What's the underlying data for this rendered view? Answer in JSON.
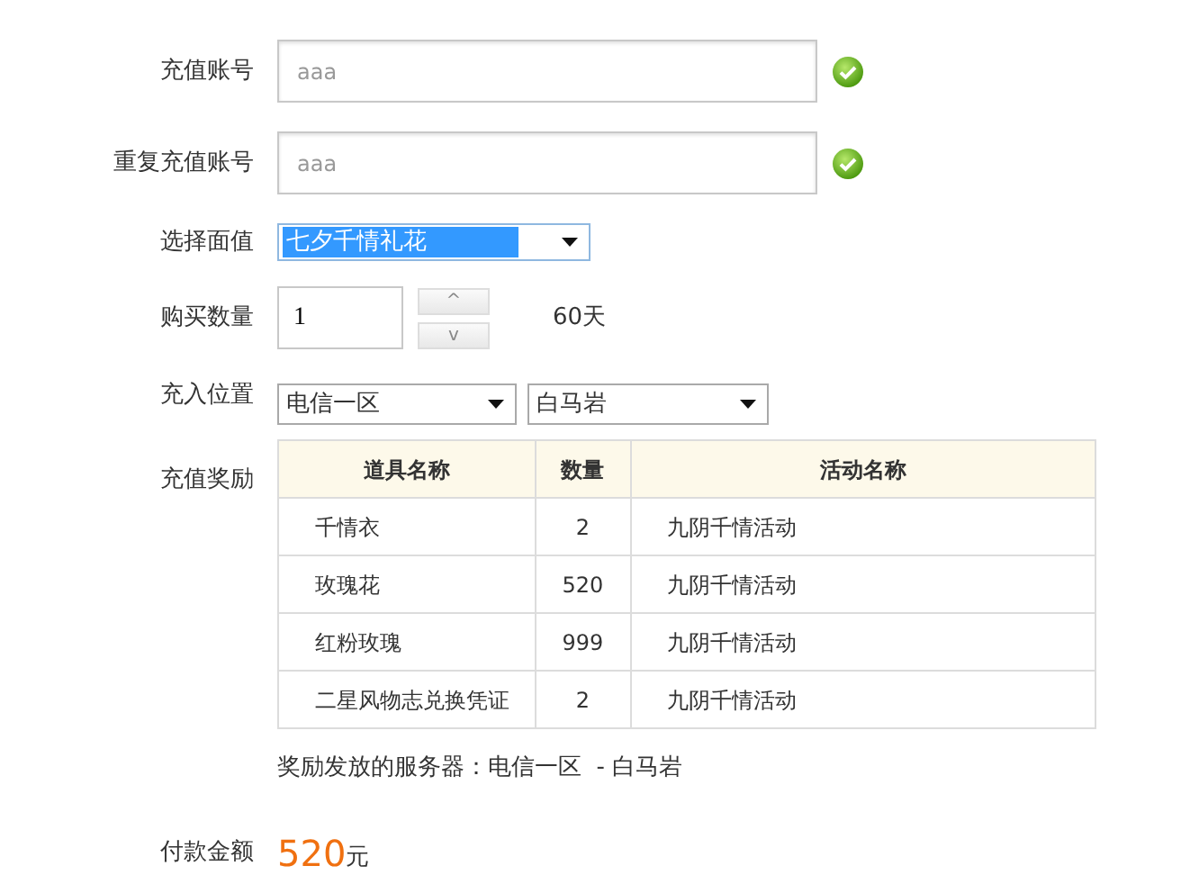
{
  "form": {
    "account": {
      "label": "充值账号",
      "value": "aaa",
      "valid": true
    },
    "account_repeat": {
      "label": "重复充值账号",
      "value": "aaa",
      "valid": true
    },
    "denomination": {
      "label": "选择面值",
      "value": "七夕千情礼花",
      "highlighted": true
    },
    "quantity": {
      "label": "购买数量",
      "value": "1",
      "up": "^",
      "down": "v",
      "duration": "60天"
    },
    "location": {
      "label": "充入位置",
      "zone": "电信一区",
      "server": "白马岩"
    },
    "rewards": {
      "label": "充值奖励",
      "columns": [
        "道具名称",
        "数量",
        "活动名称"
      ],
      "rows": [
        [
          "千情衣",
          "2",
          "九阴千情活动"
        ],
        [
          "玫瑰花",
          "520",
          "九阴千情活动"
        ],
        [
          "红粉玫瑰",
          "999",
          "九阴千情活动"
        ],
        [
          "二星风物志兑换凭证",
          "2",
          "九阴千情活动"
        ]
      ],
      "server_note": "奖励发放的服务器：电信一区  - 白马岩"
    },
    "payment": {
      "label": "付款金额",
      "amount": "520",
      "unit": "元"
    }
  }
}
